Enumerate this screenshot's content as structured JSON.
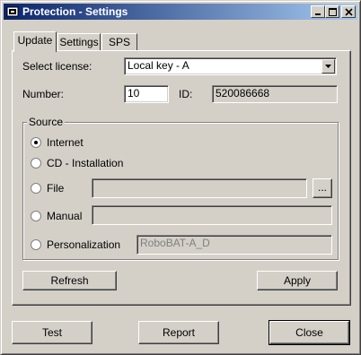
{
  "window": {
    "title": "Protection - Settings"
  },
  "tabs": [
    {
      "label": "Update",
      "active": true
    },
    {
      "label": "Settings",
      "active": false
    },
    {
      "label": "SPS",
      "active": false
    }
  ],
  "license": {
    "label": "Select license:",
    "value": "Local key - A"
  },
  "number": {
    "label": "Number:",
    "value": "10"
  },
  "id": {
    "label": "ID:",
    "value": "520086668"
  },
  "source": {
    "title": "Source",
    "options": [
      {
        "label": "Internet",
        "selected": true
      },
      {
        "label": "CD - Installation",
        "selected": false
      },
      {
        "label": "File",
        "selected": false
      },
      {
        "label": "Manual",
        "selected": false
      },
      {
        "label": "Personalization",
        "selected": false
      }
    ],
    "file_value": "",
    "browse_label": "...",
    "manual_value": "",
    "personalization_value": "RoboBAT-A_D"
  },
  "panel_buttons": {
    "refresh": "Refresh",
    "apply": "Apply"
  },
  "footer_buttons": {
    "test": "Test",
    "report": "Report",
    "close": "Close"
  }
}
